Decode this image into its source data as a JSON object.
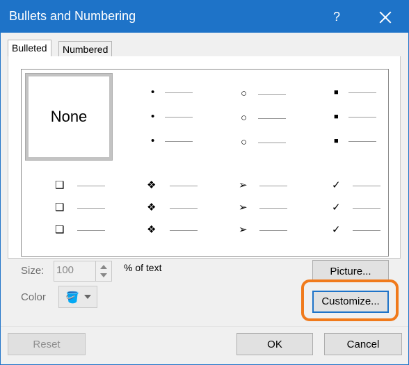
{
  "window": {
    "title": "Bullets and Numbering",
    "help": "?"
  },
  "tabs": [
    {
      "label": "Bulleted"
    },
    {
      "label": "Numbered"
    }
  ],
  "gallery": {
    "none_label": "None",
    "cells": [
      {
        "glyph": "•"
      },
      {
        "glyph": "○"
      },
      {
        "glyph": "■"
      },
      {
        "glyph": "❑"
      },
      {
        "glyph": "❖"
      },
      {
        "glyph": "➢"
      },
      {
        "glyph": "✓"
      }
    ]
  },
  "size": {
    "label": "Size:",
    "value": "100",
    "unit_text": "% of text"
  },
  "color": {
    "label": "Color",
    "icon": "paint-bucket-icon"
  },
  "buttons": {
    "picture": "Picture...",
    "customize": "Customize...",
    "reset": "Reset",
    "ok": "OK",
    "cancel": "Cancel"
  },
  "colors": {
    "title_bar": "#1e73c8",
    "highlight": "#f07a1c"
  }
}
